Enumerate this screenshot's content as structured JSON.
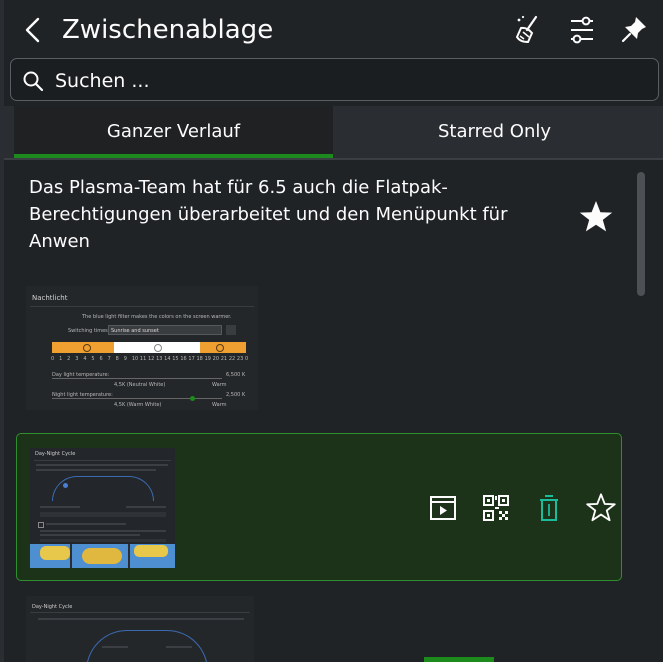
{
  "header": {
    "title": "Zwischenablage",
    "back_icon": "chevron-left-icon",
    "clear_icon": "broom-icon",
    "configure_icon": "sliders-icon",
    "pin_icon": "pin-icon"
  },
  "search": {
    "placeholder": "Suchen ...",
    "value": ""
  },
  "tabs": [
    {
      "label": "Ganzer Verlauf",
      "active": true
    },
    {
      "label": "Starred Only",
      "active": false
    }
  ],
  "entries": [
    {
      "type": "text",
      "text": "Das Plasma-Team hat für 6.5 auch die Flatpak-Berechtigungen überarbeitet und den Menüpunkt für Anwen",
      "starred": true
    },
    {
      "type": "image",
      "caption": "Nachtlicht",
      "subtitle": "The blue light filter makes the colors on the screen warmer.",
      "switching_label": "Switching times:",
      "switching_value": "Sunrise and sunset",
      "hours": [
        "0",
        "1",
        "2",
        "3",
        "4",
        "5",
        "6",
        "7",
        "8",
        "9",
        "10",
        "11",
        "12",
        "13",
        "14",
        "15",
        "16",
        "17",
        "18",
        "19",
        "20",
        "21",
        "22",
        "23",
        "0"
      ],
      "day_label": "Day light temperature:",
      "day_value": "6,500 K",
      "day_scale": "4,5K (Neutral White)",
      "day_warm": "Warm",
      "night_label": "Night light temperature:",
      "night_value": "2,500 K",
      "night_scale": "4,5K (Warm White)",
      "night_warm": "Warm"
    },
    {
      "type": "image",
      "caption": "Day-Night Cycle",
      "selected": true,
      "starred": false,
      "actions": [
        "preview-icon",
        "qr-code-icon",
        "trash-icon",
        "star-outline-icon"
      ]
    },
    {
      "type": "image",
      "caption": "Day-Night Cycle"
    }
  ],
  "colors": {
    "accent": "#1c8a1c",
    "selection_bg": "#1d3319",
    "delete_icon": "#1abc9c",
    "night_band": "#f0a030"
  }
}
